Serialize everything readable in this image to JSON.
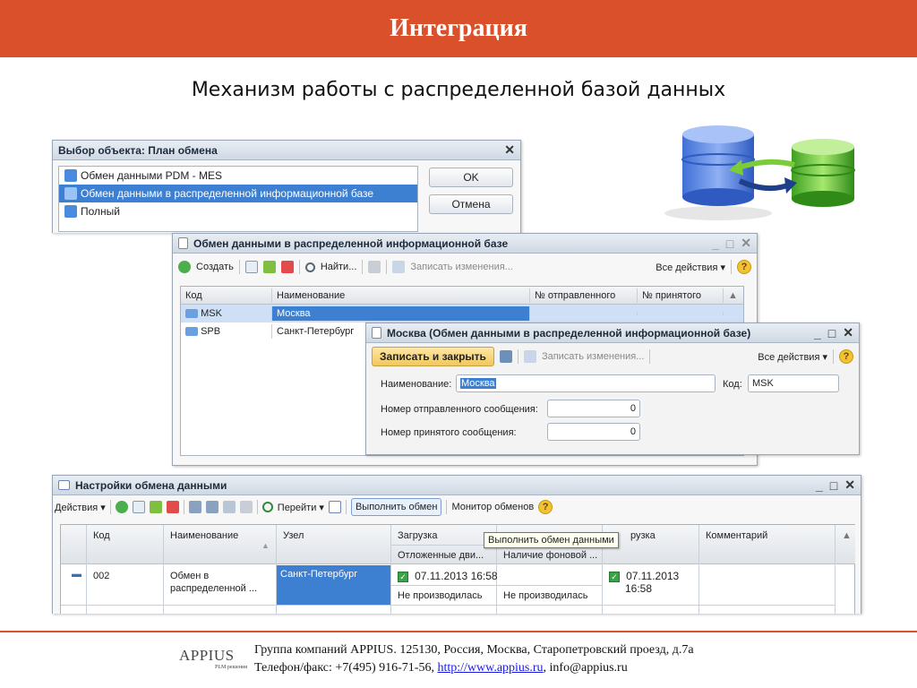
{
  "slide": {
    "title": "Интеграция",
    "subtitle": "Механизм работы с распределенной базой данных"
  },
  "colors": {
    "banner": "#d9502a",
    "selection": "#3d7fd1",
    "ok_green": "#3aa34a"
  },
  "select_dialog": {
    "title": "Выбор объекта: План обмена",
    "items": [
      "Обмен данными PDM - MES",
      "Обмен данными в распределенной информационной базе",
      "Полный"
    ],
    "ok": "OK",
    "cancel": "Отмена"
  },
  "exchange_list": {
    "title": "Обмен данными в распределенной информационной базе",
    "toolbar": {
      "create": "Создать",
      "find": "Найти...",
      "save_changes": "Записать изменения...",
      "all_actions": "Все действия ▾"
    },
    "columns": [
      "Код",
      "Наименование",
      "№ отправленного",
      "№ принятого"
    ],
    "rows": [
      {
        "code": "MSK",
        "name": "Москва"
      },
      {
        "code": "SPB",
        "name": "Санкт-Петербург"
      }
    ]
  },
  "node_form": {
    "title": "Москва (Обмен данными в распределенной информационной базе)",
    "toolbar": {
      "save_close": "Записать и закрыть",
      "save_changes": "Записать изменения...",
      "all_actions": "Все действия ▾"
    },
    "name_label": "Наименование:",
    "name_value": "Москва",
    "code_label": "Код:",
    "code_value": "MSK",
    "sent_label": "Номер отправленного сообщения:",
    "sent_value": "0",
    "received_label": "Номер принятого сообщения:",
    "received_value": "0"
  },
  "settings": {
    "title": "Настройки обмена данными",
    "toolbar": {
      "actions": "Действия ▾",
      "goto": "Перейти ▾",
      "run_exchange": "Выполнить обмен",
      "monitor": "Монитор обменов"
    },
    "columns": {
      "code": "Код",
      "name": "Наименование",
      "node": "Узел",
      "load": "Загрузка",
      "unload": "рузка",
      "comment": "Комментарий",
      "deferred": "Отложенные дви...",
      "background": "Наличие фоновой ..."
    },
    "row": {
      "code": "002",
      "name_line1": "Обмен в",
      "name_line2": "распределенной ...",
      "node": "Санкт-Петербург",
      "load_date": "07.11.2013 16:58",
      "unload_date_line1": "07.11.2013",
      "unload_date_line2": "16:58",
      "not_done_1": "Не производилась",
      "not_done_2": "Не производилась"
    },
    "tooltip": "Выполнить обмен данными"
  },
  "footer": {
    "logo_text": "APPIUS",
    "logo_sub": "PLM решения",
    "line1": "Группа компаний APPIUS. 125130, Россия, Москва, Старопетровский проезд, д.7а",
    "line2_prefix": "Телефон/факс: +7(495) 916-71-56, ",
    "link": "http://www.appius.ru",
    "line2_suffix": ", info@appius.ru"
  }
}
